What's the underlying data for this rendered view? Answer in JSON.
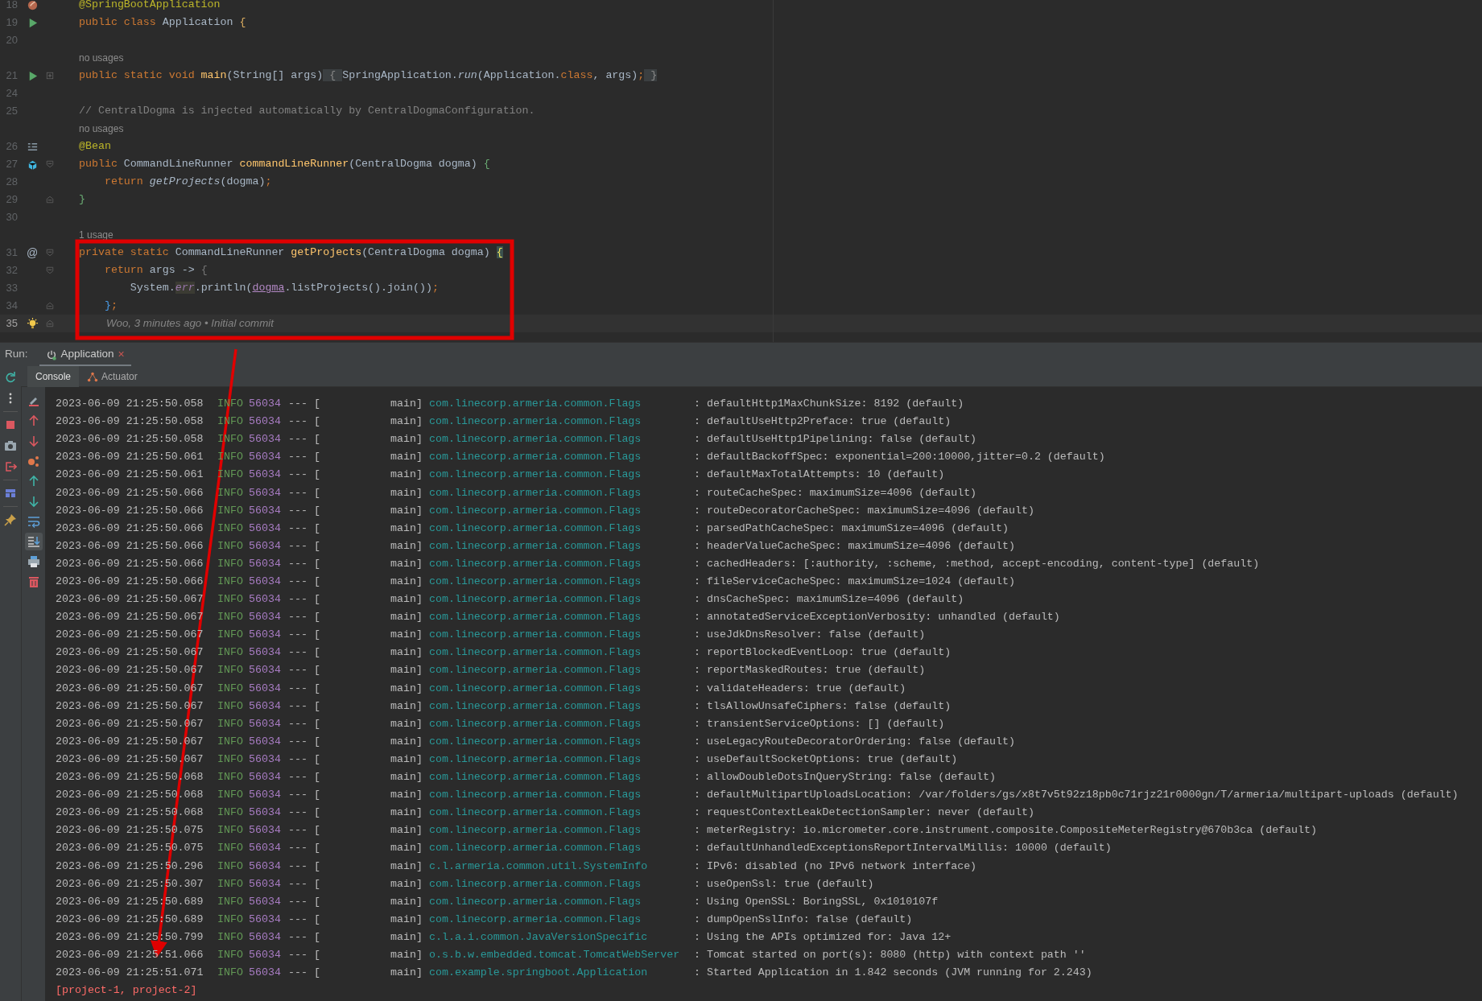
{
  "editor": {
    "lines": [
      {
        "kind": "code",
        "number": "18",
        "marker": {
          "kind": "spring"
        },
        "tokens": [
          {
            "kind": "ann",
            "text": "@SpringBootApplication"
          }
        ]
      },
      {
        "kind": "code",
        "number": "19",
        "marker": {
          "kind": "run"
        },
        "tokens": [
          {
            "kind": "kw",
            "text": "public class "
          },
          {
            "kind": "plain",
            "text": "Application "
          },
          {
            "kind": "brace-gold",
            "text": "{"
          }
        ]
      },
      {
        "kind": "code",
        "number": "20"
      },
      {
        "kind": "hint",
        "text": "no usages"
      },
      {
        "kind": "code",
        "number": "21",
        "marker": {
          "kind": "run"
        },
        "fold": {
          "kind": "plus"
        },
        "tokens": [
          {
            "kind": "kw",
            "text": "public static void "
          },
          {
            "kind": "fn",
            "text": "main"
          },
          {
            "kind": "plain",
            "text": "(String[] args)"
          },
          {
            "kind": "folded",
            "text": " { "
          },
          {
            "kind": "plain",
            "text": "SpringApplication."
          },
          {
            "kind": "italic",
            "text": "run"
          },
          {
            "kind": "plain",
            "text": "(Application."
          },
          {
            "kind": "kw",
            "text": "class"
          },
          {
            "kind": "plain",
            "text": ", args)"
          },
          {
            "kind": "kw",
            "text": ";"
          },
          {
            "kind": "folded",
            "text": " }"
          }
        ]
      },
      {
        "kind": "code",
        "number": "24"
      },
      {
        "kind": "code",
        "number": "25",
        "tokens": [
          {
            "kind": "comment",
            "text": "// CentralDogma is injected automatically by CentralDogmaConfiguration."
          }
        ]
      },
      {
        "kind": "hint",
        "text": "no usages"
      },
      {
        "kind": "code",
        "number": "26",
        "marker": {
          "kind": "list"
        },
        "tokens": [
          {
            "kind": "ann",
            "text": "@Bean"
          }
        ]
      },
      {
        "kind": "code",
        "number": "27",
        "marker": {
          "kind": "bean"
        },
        "fold": {
          "kind": "start"
        },
        "tokens": [
          {
            "kind": "kw",
            "text": "public "
          },
          {
            "kind": "plain",
            "text": "CommandLineRunner "
          },
          {
            "kind": "fn",
            "text": "commandLineRunner"
          },
          {
            "kind": "plain",
            "text": "(CentralDogma dogma) "
          },
          {
            "kind": "brace-green",
            "text": "{"
          }
        ]
      },
      {
        "kind": "code",
        "number": "28",
        "tokens": [
          {
            "kind": "kw",
            "text": "    return "
          },
          {
            "kind": "italic",
            "text": "getProjects"
          },
          {
            "kind": "plain",
            "text": "(dogma)"
          },
          {
            "kind": "kw",
            "text": ";"
          }
        ]
      },
      {
        "kind": "code",
        "number": "29",
        "fold": {
          "kind": "end"
        },
        "tokens": [
          {
            "kind": "brace-green",
            "text": "}"
          }
        ]
      },
      {
        "kind": "code",
        "number": "30"
      },
      {
        "kind": "hint",
        "text": "1 usage"
      },
      {
        "kind": "code",
        "number": "31",
        "marker": {
          "kind": "at",
          "text": "@"
        },
        "fold": {
          "kind": "start"
        },
        "tokens": [
          {
            "kind": "kw",
            "text": "private static "
          },
          {
            "kind": "plain",
            "text": "CommandLineRunner "
          },
          {
            "kind": "fn",
            "text": "getProjects"
          },
          {
            "kind": "plain",
            "text": "(CentralDogma dogma) "
          },
          {
            "kind": "brace-gold-hl",
            "text": "{"
          }
        ]
      },
      {
        "kind": "code",
        "number": "32",
        "fold": {
          "kind": "start"
        },
        "tokens": [
          {
            "kind": "kw",
            "text": "    return "
          },
          {
            "kind": "plain",
            "text": "args -> "
          },
          {
            "kind": "brace-grey",
            "text": "{"
          }
        ]
      },
      {
        "kind": "code",
        "number": "33",
        "tokens": [
          {
            "kind": "plain",
            "text": "        System."
          },
          {
            "kind": "static",
            "text": "err"
          },
          {
            "kind": "plain",
            "text": ".println("
          },
          {
            "kind": "param",
            "text": "dogma"
          },
          {
            "kind": "plain",
            "text": ".listProjects().join())"
          },
          {
            "kind": "kw",
            "text": ";"
          }
        ]
      },
      {
        "kind": "code",
        "number": "34",
        "fold": {
          "kind": "end"
        },
        "tokens": [
          {
            "kind": "brace-blue",
            "text": "    }"
          },
          {
            "kind": "kw",
            "text": ";"
          }
        ]
      },
      {
        "kind": "code",
        "number": "35",
        "marker": {
          "kind": "bulb"
        },
        "fold": {
          "kind": "end"
        },
        "current": true,
        "tokens": [
          {
            "kind": "blame",
            "text": "Woo, 3 minutes ago • Initial commit"
          }
        ]
      }
    ]
  },
  "run_bar": {
    "label": "Run:",
    "tabs": [
      {
        "label": "Application",
        "selected": true,
        "close": "×"
      }
    ]
  },
  "console": {
    "tabs": [
      {
        "label": "Console",
        "selected": true,
        "kind": "console"
      },
      {
        "label": "Actuator",
        "selected": false,
        "kind": "actuator"
      }
    ],
    "side_tools": [
      {
        "kind": "rerun"
      },
      {
        "kind": "more"
      },
      {
        "kind": "sep"
      },
      {
        "kind": "stop"
      },
      {
        "kind": "camera"
      },
      {
        "kind": "exit"
      },
      {
        "kind": "sep"
      },
      {
        "kind": "layout"
      },
      {
        "kind": "sep"
      },
      {
        "kind": "pin"
      }
    ],
    "tools": [
      {
        "kind": "clear",
        "selected": false
      },
      {
        "kind": "up-red",
        "selected": false
      },
      {
        "kind": "down-red",
        "selected": false
      },
      {
        "kind": "nodes",
        "selected": false
      },
      {
        "kind": "up",
        "selected": false
      },
      {
        "kind": "down",
        "selected": false
      },
      {
        "kind": "wrap",
        "selected": false
      },
      {
        "kind": "scroll-end",
        "selected": true
      },
      {
        "kind": "print",
        "selected": false
      },
      {
        "kind": "trash",
        "selected": false
      }
    ],
    "rows": [
      {
        "time": "2023-06-09 21:25:50.058",
        "level": "INFO",
        "pid": "56034",
        "sep": "--- [",
        "thread": "main]",
        "logger": "com.linecorp.armeria.common.Flags",
        "message": ": defaultHttp1MaxChunkSize: 8192 (default)"
      },
      {
        "time": "2023-06-09 21:25:50.058",
        "level": "INFO",
        "pid": "56034",
        "sep": "--- [",
        "thread": "main]",
        "logger": "com.linecorp.armeria.common.Flags",
        "message": ": defaultUseHttp2Preface: true (default)"
      },
      {
        "time": "2023-06-09 21:25:50.058",
        "level": "INFO",
        "pid": "56034",
        "sep": "--- [",
        "thread": "main]",
        "logger": "com.linecorp.armeria.common.Flags",
        "message": ": defaultUseHttp1Pipelining: false (default)"
      },
      {
        "time": "2023-06-09 21:25:50.061",
        "level": "INFO",
        "pid": "56034",
        "sep": "--- [",
        "thread": "main]",
        "logger": "com.linecorp.armeria.common.Flags",
        "message": ": defaultBackoffSpec: exponential=200:10000,jitter=0.2 (default)"
      },
      {
        "time": "2023-06-09 21:25:50.061",
        "level": "INFO",
        "pid": "56034",
        "sep": "--- [",
        "thread": "main]",
        "logger": "com.linecorp.armeria.common.Flags",
        "message": ": defaultMaxTotalAttempts: 10 (default)"
      },
      {
        "time": "2023-06-09 21:25:50.066",
        "level": "INFO",
        "pid": "56034",
        "sep": "--- [",
        "thread": "main]",
        "logger": "com.linecorp.armeria.common.Flags",
        "message": ": routeCacheSpec: maximumSize=4096 (default)"
      },
      {
        "time": "2023-06-09 21:25:50.066",
        "level": "INFO",
        "pid": "56034",
        "sep": "--- [",
        "thread": "main]",
        "logger": "com.linecorp.armeria.common.Flags",
        "message": ": routeDecoratorCacheSpec: maximumSize=4096 (default)"
      },
      {
        "time": "2023-06-09 21:25:50.066",
        "level": "INFO",
        "pid": "56034",
        "sep": "--- [",
        "thread": "main]",
        "logger": "com.linecorp.armeria.common.Flags",
        "message": ": parsedPathCacheSpec: maximumSize=4096 (default)"
      },
      {
        "time": "2023-06-09 21:25:50.066",
        "level": "INFO",
        "pid": "56034",
        "sep": "--- [",
        "thread": "main]",
        "logger": "com.linecorp.armeria.common.Flags",
        "message": ": headerValueCacheSpec: maximumSize=4096 (default)"
      },
      {
        "time": "2023-06-09 21:25:50.066",
        "level": "INFO",
        "pid": "56034",
        "sep": "--- [",
        "thread": "main]",
        "logger": "com.linecorp.armeria.common.Flags",
        "message": ": cachedHeaders: [:authority, :scheme, :method, accept-encoding, content-type] (default)"
      },
      {
        "time": "2023-06-09 21:25:50.066",
        "level": "INFO",
        "pid": "56034",
        "sep": "--- [",
        "thread": "main]",
        "logger": "com.linecorp.armeria.common.Flags",
        "message": ": fileServiceCacheSpec: maximumSize=1024 (default)"
      },
      {
        "time": "2023-06-09 21:25:50.067",
        "level": "INFO",
        "pid": "56034",
        "sep": "--- [",
        "thread": "main]",
        "logger": "com.linecorp.armeria.common.Flags",
        "message": ": dnsCacheSpec: maximumSize=4096 (default)"
      },
      {
        "time": "2023-06-09 21:25:50.067",
        "level": "INFO",
        "pid": "56034",
        "sep": "--- [",
        "thread": "main]",
        "logger": "com.linecorp.armeria.common.Flags",
        "message": ": annotatedServiceExceptionVerbosity: unhandled (default)"
      },
      {
        "time": "2023-06-09 21:25:50.067",
        "level": "INFO",
        "pid": "56034",
        "sep": "--- [",
        "thread": "main]",
        "logger": "com.linecorp.armeria.common.Flags",
        "message": ": useJdkDnsResolver: false (default)"
      },
      {
        "time": "2023-06-09 21:25:50.067",
        "level": "INFO",
        "pid": "56034",
        "sep": "--- [",
        "thread": "main]",
        "logger": "com.linecorp.armeria.common.Flags",
        "message": ": reportBlockedEventLoop: true (default)"
      },
      {
        "time": "2023-06-09 21:25:50.067",
        "level": "INFO",
        "pid": "56034",
        "sep": "--- [",
        "thread": "main]",
        "logger": "com.linecorp.armeria.common.Flags",
        "message": ": reportMaskedRoutes: true (default)"
      },
      {
        "time": "2023-06-09 21:25:50.067",
        "level": "INFO",
        "pid": "56034",
        "sep": "--- [",
        "thread": "main]",
        "logger": "com.linecorp.armeria.common.Flags",
        "message": ": validateHeaders: true (default)"
      },
      {
        "time": "2023-06-09 21:25:50.067",
        "level": "INFO",
        "pid": "56034",
        "sep": "--- [",
        "thread": "main]",
        "logger": "com.linecorp.armeria.common.Flags",
        "message": ": tlsAllowUnsafeCiphers: false (default)"
      },
      {
        "time": "2023-06-09 21:25:50.067",
        "level": "INFO",
        "pid": "56034",
        "sep": "--- [",
        "thread": "main]",
        "logger": "com.linecorp.armeria.common.Flags",
        "message": ": transientServiceOptions: [] (default)"
      },
      {
        "time": "2023-06-09 21:25:50.067",
        "level": "INFO",
        "pid": "56034",
        "sep": "--- [",
        "thread": "main]",
        "logger": "com.linecorp.armeria.common.Flags",
        "message": ": useLegacyRouteDecoratorOrdering: false (default)"
      },
      {
        "time": "2023-06-09 21:25:50.067",
        "level": "INFO",
        "pid": "56034",
        "sep": "--- [",
        "thread": "main]",
        "logger": "com.linecorp.armeria.common.Flags",
        "message": ": useDefaultSocketOptions: true (default)"
      },
      {
        "time": "2023-06-09 21:25:50.068",
        "level": "INFO",
        "pid": "56034",
        "sep": "--- [",
        "thread": "main]",
        "logger": "com.linecorp.armeria.common.Flags",
        "message": ": allowDoubleDotsInQueryString: false (default)"
      },
      {
        "time": "2023-06-09 21:25:50.068",
        "level": "INFO",
        "pid": "56034",
        "sep": "--- [",
        "thread": "main]",
        "logger": "com.linecorp.armeria.common.Flags",
        "message": ": defaultMultipartUploadsLocation: /var/folders/gs/x8t7v5t92z18pb0c71rjz21r0000gn/T/armeria/multipart-uploads (default)"
      },
      {
        "time": "2023-06-09 21:25:50.068",
        "level": "INFO",
        "pid": "56034",
        "sep": "--- [",
        "thread": "main]",
        "logger": "com.linecorp.armeria.common.Flags",
        "message": ": requestContextLeakDetectionSampler: never (default)"
      },
      {
        "time": "2023-06-09 21:25:50.075",
        "level": "INFO",
        "pid": "56034",
        "sep": "--- [",
        "thread": "main]",
        "logger": "com.linecorp.armeria.common.Flags",
        "message": ": meterRegistry: io.micrometer.core.instrument.composite.CompositeMeterRegistry@670b3ca (default)"
      },
      {
        "time": "2023-06-09 21:25:50.075",
        "level": "INFO",
        "pid": "56034",
        "sep": "--- [",
        "thread": "main]",
        "logger": "com.linecorp.armeria.common.Flags",
        "message": ": defaultUnhandledExceptionsReportIntervalMillis: 10000 (default)"
      },
      {
        "time": "2023-06-09 21:25:50.296",
        "level": "INFO",
        "pid": "56034",
        "sep": "--- [",
        "thread": "main]",
        "logger": "c.l.armeria.common.util.SystemInfo",
        "message": ": IPv6: disabled (no IPv6 network interface)"
      },
      {
        "time": "2023-06-09 21:25:50.307",
        "level": "INFO",
        "pid": "56034",
        "sep": "--- [",
        "thread": "main]",
        "logger": "com.linecorp.armeria.common.Flags",
        "message": ": useOpenSsl: true (default)"
      },
      {
        "time": "2023-06-09 21:25:50.689",
        "level": "INFO",
        "pid": "56034",
        "sep": "--- [",
        "thread": "main]",
        "logger": "com.linecorp.armeria.common.Flags",
        "message": ": Using OpenSSL: BoringSSL, 0x1010107f"
      },
      {
        "time": "2023-06-09 21:25:50.689",
        "level": "INFO",
        "pid": "56034",
        "sep": "--- [",
        "thread": "main]",
        "logger": "com.linecorp.armeria.common.Flags",
        "message": ": dumpOpenSslInfo: false (default)"
      },
      {
        "time": "2023-06-09 21:25:50.799",
        "level": "INFO",
        "pid": "56034",
        "sep": "--- [",
        "thread": "main]",
        "logger": "c.l.a.i.common.JavaVersionSpecific",
        "message": ": Using the APIs optimized for: Java 12+"
      },
      {
        "time": "2023-06-09 21:25:51.066",
        "level": "INFO",
        "pid": "56034",
        "sep": "--- [",
        "thread": "main]",
        "logger": "o.s.b.w.embedded.tomcat.TomcatWebServer",
        "message": ": Tomcat started on port(s): 8080 (http) with context path ''"
      },
      {
        "time": "2023-06-09 21:25:51.071",
        "level": "INFO",
        "pid": "56034",
        "sep": "--- [",
        "thread": "main]",
        "logger": "com.example.springboot.Application",
        "message": ": Started Application in 1.842 seconds (JVM running for 2.243)"
      }
    ],
    "output": [
      "[project-1, project-2]"
    ]
  }
}
